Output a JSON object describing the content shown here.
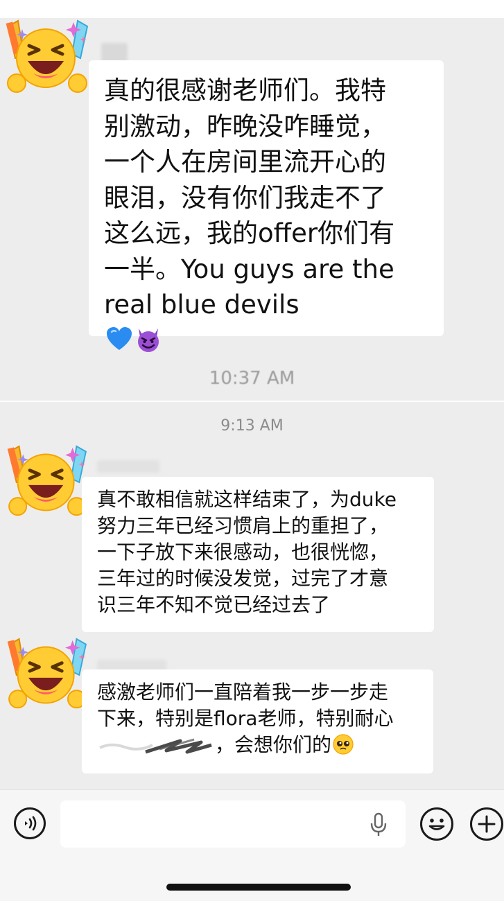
{
  "chat": {
    "messages": [
      {
        "text": "真的很感谢老师们。我特\n别激动，昨晚没咋睡觉，\n一个人在房间里流开心的\n眼泪，没有你们我走不了\n这么远，我的offer你们有\n一半。You guys are the\nreal blue devils",
        "trailing_emojis": [
          "blue-heart",
          "smiling-devil"
        ]
      },
      {
        "text": "真不敢相信就这样结束了，为duke\n努力三年已经习惯肩上的重担了，\n一下子放下来很感动，也很恍惚，\n三年过的时候没发觉，过完了才意\n识三年不知不觉已经过去了"
      },
      {
        "text_before_redaction": "感激老师们一直陪着我一步一步走\n下来，特别是flora老师，特别耐心\n",
        "text_after_redaction": "，会想你们的",
        "trailing_emojis": [
          "pleading-face"
        ]
      }
    ],
    "timestamps": [
      "10:37 AM",
      "9:13 AM"
    ]
  },
  "input_bar": {
    "placeholder": "",
    "icons": [
      "voice-icon",
      "mic-icon",
      "emoji-icon",
      "plus-icon"
    ]
  },
  "colors": {
    "chat_background": "#ededed",
    "bubble_background": "#ffffff",
    "timestamp_text": "#8c8c8c",
    "input_bar_background": "#f6f6f6"
  }
}
